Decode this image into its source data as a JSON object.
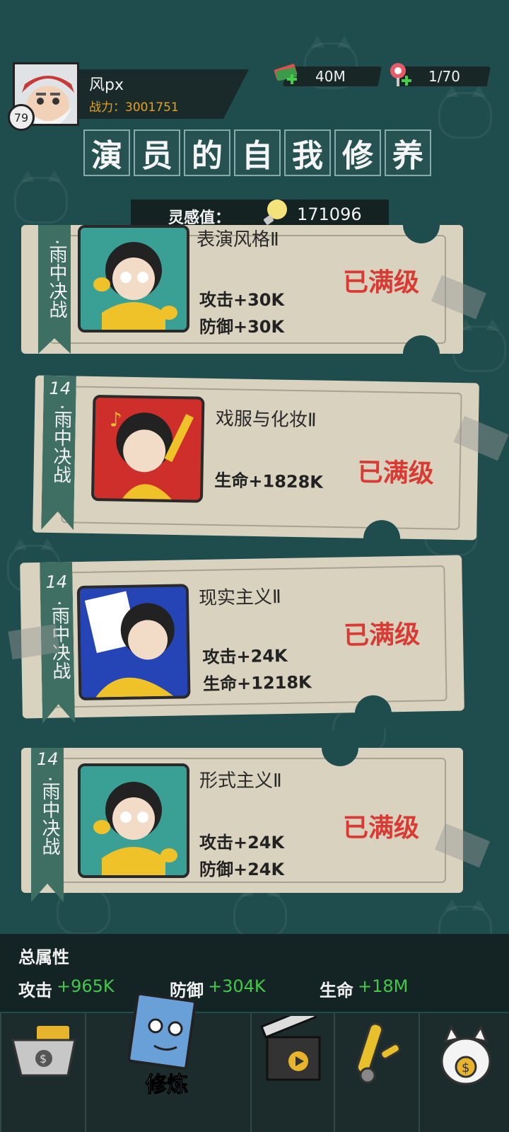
{
  "player": {
    "name": "风px",
    "level": "79",
    "power_label": "战力：3001751"
  },
  "resources": {
    "money": "40M",
    "tickets": "1/70"
  },
  "title_chars": [
    "演",
    "员",
    "的",
    "自",
    "我",
    "修",
    "养"
  ],
  "inspiration": {
    "label": "灵感值：",
    "value": "171096"
  },
  "cards": [
    {
      "level": "",
      "chapter": "·雨中决战",
      "skill": "表演风格Ⅱ",
      "stats": [
        "攻击+30K",
        "防御+30K"
      ],
      "status": "已满级"
    },
    {
      "level": "14",
      "chapter": "·雨中决战",
      "skill": "戏服与化妆Ⅱ",
      "stats": [
        "生命+1828K"
      ],
      "status": "已满级"
    },
    {
      "level": "14",
      "chapter": "·雨中决战",
      "skill": "现实主义Ⅱ",
      "stats": [
        "攻击+24K",
        "生命+1218K"
      ],
      "status": "已满级"
    },
    {
      "level": "14",
      "chapter": "·雨中决战",
      "skill": "形式主义Ⅱ",
      "stats": [
        "攻击+24K",
        "防御+24K"
      ],
      "status": "已满级"
    }
  ],
  "totals": {
    "title": "总属性",
    "attack_label": "攻击",
    "attack_value": "+965K",
    "defense_label": "防御",
    "defense_value": "+304K",
    "life_label": "生命",
    "life_value": "+18M"
  },
  "tabs": {
    "active_label": "修炼"
  },
  "colors": {
    "background": "#1f4d4d",
    "maxed": "#d93a33",
    "bonus": "#43c84a",
    "power": "#e6a317"
  }
}
